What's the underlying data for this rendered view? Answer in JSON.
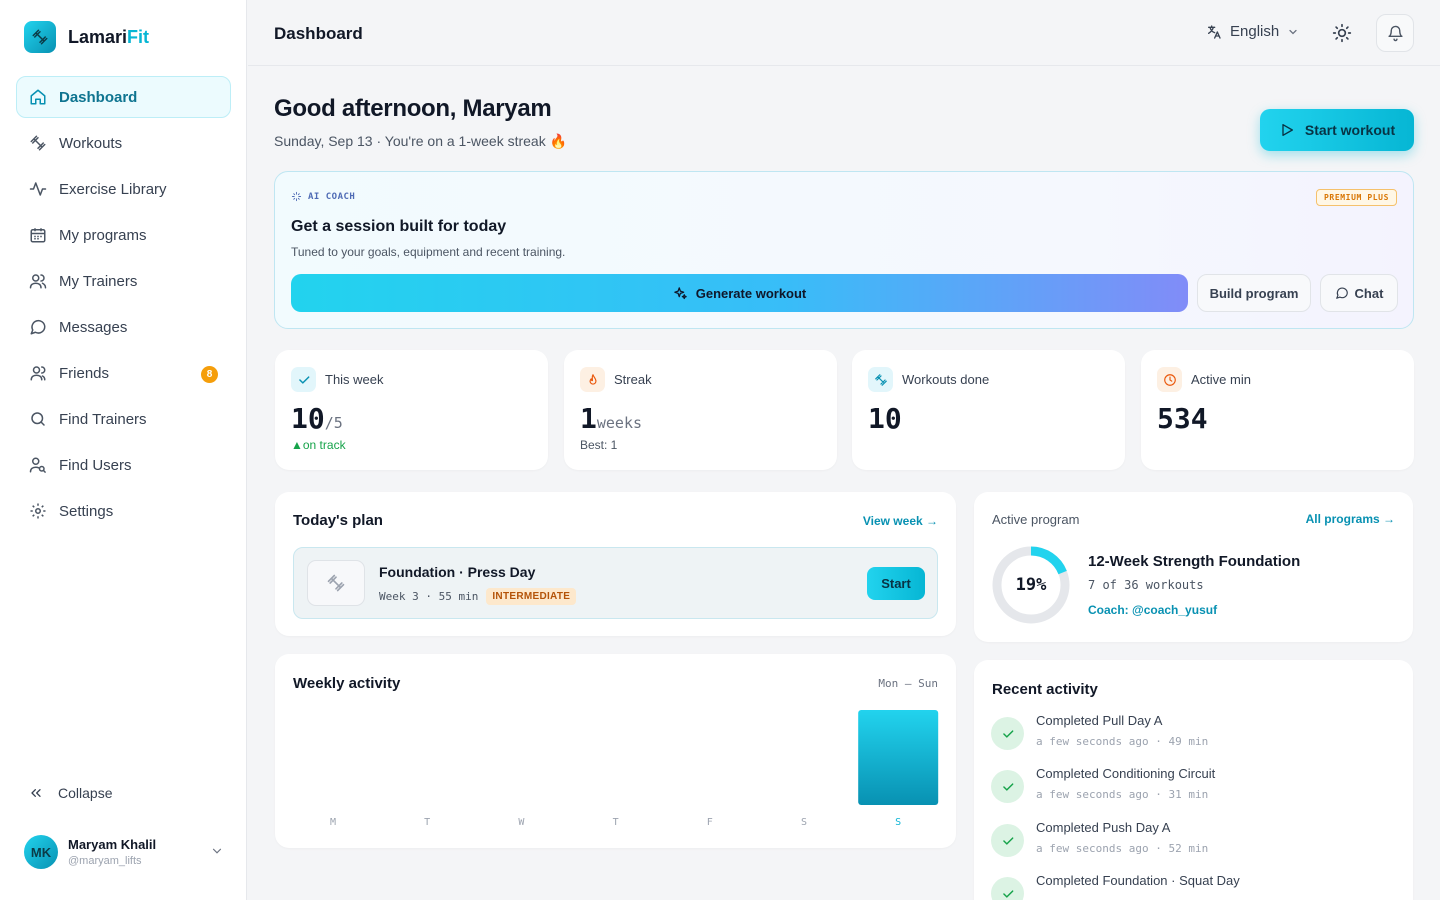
{
  "brand": {
    "name_main": "Lamari",
    "name_accent": "Fit"
  },
  "sidebar": {
    "items": [
      {
        "label": "Dashboard",
        "icon": "home-icon",
        "active": true
      },
      {
        "label": "Workouts",
        "icon": "dumbbell-icon"
      },
      {
        "label": "Exercise Library",
        "icon": "activity-icon"
      },
      {
        "label": "My programs",
        "icon": "calendar-icon"
      },
      {
        "label": "My Trainers",
        "icon": "users-icon"
      },
      {
        "label": "Messages",
        "icon": "message-icon"
      },
      {
        "label": "Friends",
        "icon": "friends-icon",
        "badge": "8"
      },
      {
        "label": "Find Trainers",
        "icon": "search-icon"
      },
      {
        "label": "Find Users",
        "icon": "user-search-icon"
      },
      {
        "label": "Settings",
        "icon": "gear-icon"
      }
    ],
    "collapse_label": "Collapse",
    "user": {
      "initials": "MK",
      "name": "Maryam Khalil",
      "handle": "@maryam_lifts"
    }
  },
  "header": {
    "title": "Dashboard",
    "language": "English"
  },
  "greeting": {
    "title": "Good afternoon, Maryam",
    "subtitle": "Sunday, Sep 13 · You're on a 1-week streak 🔥",
    "start_button": "Start workout"
  },
  "coach": {
    "tag": "AI COACH",
    "premium": "PREMIUM PLUS",
    "title": "Get a session built for today",
    "subtitle": "Tuned to your goals, equipment and recent training.",
    "generate_label": "Generate workout",
    "build_label": "Build program",
    "chat_label": "Chat"
  },
  "stats": [
    {
      "label": "This week",
      "value": "10",
      "unit": "/5",
      "note": "▲on track",
      "icon": "check-icon"
    },
    {
      "label": "Streak",
      "value": "1",
      "unit": " weeks",
      "note": "Best: 1",
      "icon": "flame-icon"
    },
    {
      "label": "Workouts done",
      "value": "10",
      "unit": "",
      "note": "",
      "icon": "dumbbell-icon"
    },
    {
      "label": "Active min",
      "value": "534",
      "unit": "",
      "note": "",
      "icon": "clock-icon"
    }
  ],
  "plan": {
    "title": "Today's plan",
    "link": "View week →",
    "name": "Foundation · Press Day",
    "meta": "Week 3 · 55 min",
    "level": "INTERMEDIATE",
    "start_label": "Start"
  },
  "program": {
    "label": "Active program",
    "link": "All programs →",
    "progress_pct": 19,
    "progress_text": "19%",
    "name": "12-Week Strength Foundation",
    "count": "7 of 36 workouts",
    "coach": "Coach: @coach_yusuf"
  },
  "weekly": {
    "title": "Weekly activity",
    "range": "Mon — Sun"
  },
  "chart_data": {
    "type": "bar",
    "categories": [
      "M",
      "T",
      "W",
      "T",
      "F",
      "S",
      "S"
    ],
    "values": [
      0,
      0,
      0,
      0,
      0,
      0,
      1
    ],
    "highlight_index": 6,
    "color": "#0fb5d6"
  },
  "recent": {
    "title": "Recent activity",
    "items": [
      {
        "title": "Completed Pull Day A",
        "meta": "a few seconds ago · 49 min"
      },
      {
        "title": "Completed Conditioning Circuit",
        "meta": "a few seconds ago · 31 min"
      },
      {
        "title": "Completed Push Day A",
        "meta": "a few seconds ago · 52 min"
      },
      {
        "title": "Completed Foundation · Squat Day",
        "meta": ""
      }
    ]
  }
}
